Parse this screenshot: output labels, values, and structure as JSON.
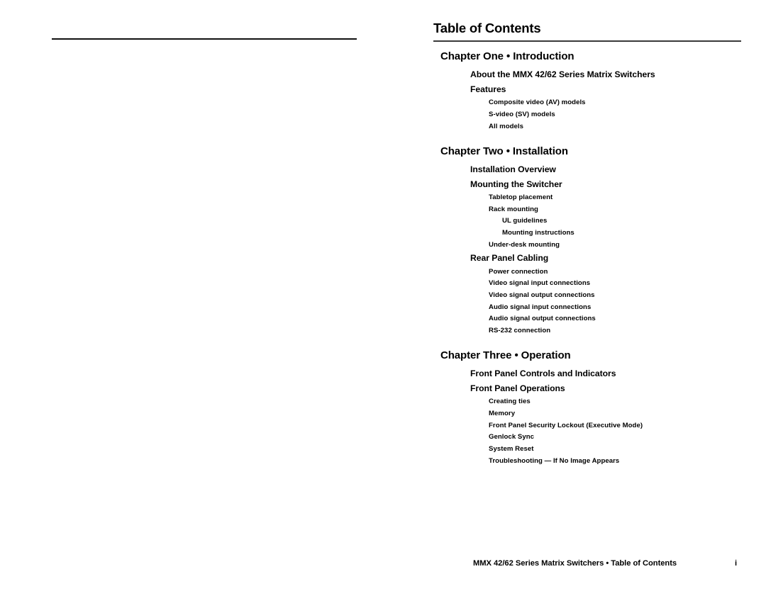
{
  "document": {
    "title": "Table of Contents",
    "page_number": "i",
    "footer_text": "MMX 42/62 Series Matrix Switchers • Table of Contents"
  },
  "left_page": {
    "blank": true
  },
  "toc": {
    "chapters": [
      {
        "heading": "Chapter One • Introduction",
        "entries": [
          {
            "level": 1,
            "label": "About the MMX 42/62 Series Matrix Switchers"
          },
          {
            "level": 1,
            "label": "Features"
          },
          {
            "level": 2,
            "label": "Composite video (AV) models"
          },
          {
            "level": 2,
            "label": "S-video (SV) models"
          },
          {
            "level": 2,
            "label": "All models"
          }
        ]
      },
      {
        "heading": "Chapter Two • Installation",
        "entries": [
          {
            "level": 1,
            "label": "Installation Overview"
          },
          {
            "level": 1,
            "label": "Mounting the Switcher"
          },
          {
            "level": 2,
            "label": "Tabletop placement"
          },
          {
            "level": 2,
            "label": "Rack mounting"
          },
          {
            "level": 3,
            "label": "UL guidelines"
          },
          {
            "level": 3,
            "label": "Mounting instructions"
          },
          {
            "level": 2,
            "label": "Under-desk mounting"
          },
          {
            "level": 1,
            "label": "Rear Panel Cabling"
          },
          {
            "level": 2,
            "label": "Power connection"
          },
          {
            "level": 2,
            "label": "Video signal input connections"
          },
          {
            "level": 2,
            "label": "Video signal output connections"
          },
          {
            "level": 2,
            "label": "Audio signal input connections"
          },
          {
            "level": 2,
            "label": "Audio signal output connections"
          },
          {
            "level": 2,
            "label": "RS-232 connection"
          }
        ]
      },
      {
        "heading": "Chapter Three • Operation",
        "entries": [
          {
            "level": 1,
            "label": "Front Panel Controls and Indicators"
          },
          {
            "level": 1,
            "label": "Front Panel Operations"
          },
          {
            "level": 2,
            "label": "Creating ties"
          },
          {
            "level": 2,
            "label": "Memory"
          },
          {
            "level": 2,
            "label": "Front Panel Security Lockout (Executive Mode)"
          },
          {
            "level": 2,
            "label": "Genlock Sync"
          },
          {
            "level": 2,
            "label": "System Reset"
          },
          {
            "level": 2,
            "label": "Troubleshooting — If No Image Appears"
          }
        ]
      }
    ]
  }
}
